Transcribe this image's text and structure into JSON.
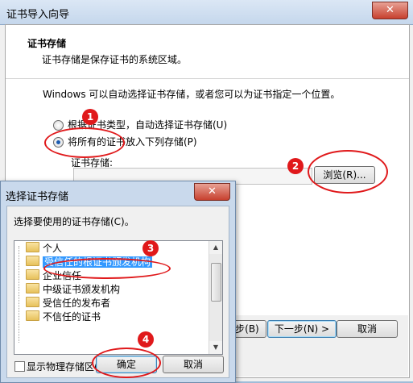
{
  "wizard": {
    "title": "证书导入向导",
    "close_glyph": "✕",
    "section_title": "证书存储",
    "section_desc": "证书存储是保存证书的系统区域。",
    "body_text": "Windows 可以自动选择证书存储，或者您可以为证书指定一个位置。",
    "radio_auto": "根据证书类型，自动选择证书存储(U)",
    "radio_manual": "将所有的证书放入下列存储(P)",
    "store_label": "证书存储:",
    "store_value": "",
    "browse_button": "浏览(R)...",
    "back_button": "< 上一步(B)",
    "next_button": "下一步(N) >",
    "cancel_button": "取消"
  },
  "dialog": {
    "title": "选择证书存储",
    "close_glyph": "✕",
    "prompt": "选择要使用的证书存储(C)。",
    "stores": [
      "个人",
      "受信任的根证书颁发机构",
      "企业信任",
      "中级证书颁发机构",
      "受信任的发布者",
      "不信任的证书"
    ],
    "selected_index": 1,
    "show_physical": "显示物理存储区(S)",
    "ok_button": "确定",
    "cancel_button": "取消"
  },
  "annotations": {
    "badges": [
      "1",
      "2",
      "3",
      "4"
    ],
    "color": "#e0191b"
  }
}
